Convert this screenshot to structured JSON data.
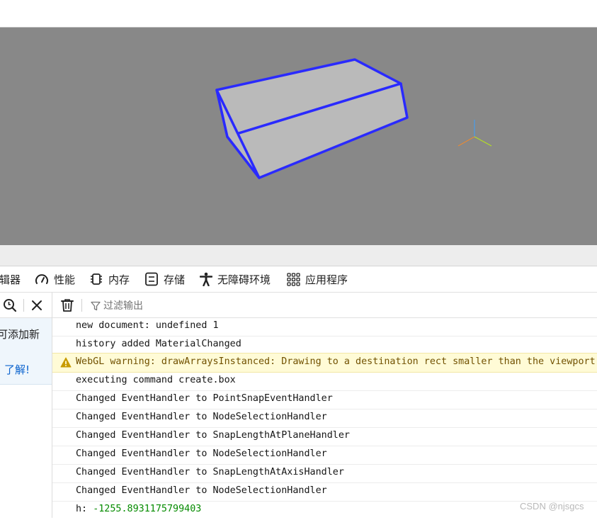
{
  "tabs": [
    {
      "label": "辑器",
      "icon": "editor-icon"
    },
    {
      "label": "性能",
      "icon": "gauge-icon"
    },
    {
      "label": "内存",
      "icon": "memory-chip-icon"
    },
    {
      "label": "存储",
      "icon": "storage-icon"
    },
    {
      "label": "无障碍环境",
      "icon": "accessibility-person-icon"
    },
    {
      "label": "应用程序",
      "icon": "app-grid-icon"
    }
  ],
  "side": {
    "info_text": "可添加新",
    "learn_link": "了解!"
  },
  "console": {
    "filter_placeholder": "过滤输出"
  },
  "logs": [
    {
      "text": "new document: undefined 1",
      "level": "log"
    },
    {
      "text": "history added MaterialChanged",
      "level": "log"
    },
    {
      "text": "WebGL warning: drawArraysInstanced: Drawing to a destination rect smaller than the viewport rect.",
      "level": "warning"
    },
    {
      "text": "executing command create.box",
      "level": "log"
    },
    {
      "text": "Changed EventHandler to PointSnapEventHandler",
      "level": "log"
    },
    {
      "text": "Changed EventHandler to NodeSelectionHandler",
      "level": "log"
    },
    {
      "text": "Changed EventHandler to SnapLengthAtPlaneHandler",
      "level": "log"
    },
    {
      "text": "Changed EventHandler to NodeSelectionHandler",
      "level": "log"
    },
    {
      "text": "Changed EventHandler to SnapLengthAtAxisHandler",
      "level": "log"
    },
    {
      "text": "Changed EventHandler to NodeSelectionHandler",
      "level": "log"
    }
  ],
  "last_log": {
    "prefix": "h:",
    "value": "-1255.8931175799403"
  },
  "watermark": "CSDN @njsgcs",
  "colors": {
    "viewport_bg": "#888888",
    "box_face": "#bababa",
    "box_edge": "#2a2aff",
    "warning_bg": "#fffbd6",
    "number_green": "#058b00",
    "link_blue": "#0b63ce"
  }
}
